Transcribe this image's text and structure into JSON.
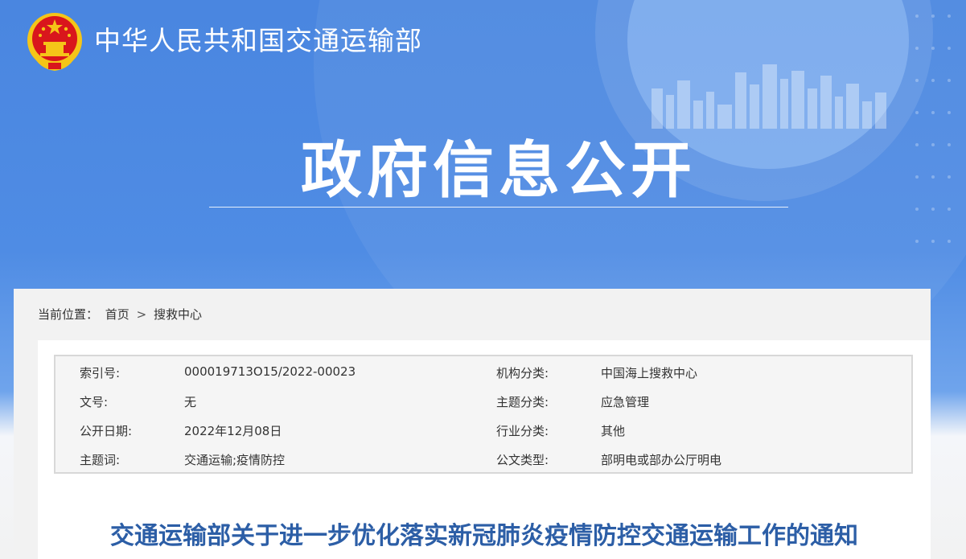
{
  "header": {
    "site_name": "中华人民共和国交通运输部",
    "hero_title": "政府信息公开"
  },
  "breadcrumb": {
    "label": "当前位置：",
    "home": "首页",
    "separator": ">",
    "current": "搜救中心"
  },
  "meta": {
    "rows": [
      {
        "k1": "索引号:",
        "v1": "000019713O15/2022-00023",
        "k2": "机构分类:",
        "v2": "中国海上搜救中心"
      },
      {
        "k1": "文号:",
        "v1": "无",
        "k2": "主题分类:",
        "v2": "应急管理"
      },
      {
        "k1": "公开日期:",
        "v1": "2022年12月08日",
        "k2": "行业分类:",
        "v2": "其他"
      },
      {
        "k1": "主题词:",
        "v1": "交通运输;疫情防控",
        "k2": "公文类型:",
        "v2": "部明电或部办公厅明电"
      }
    ]
  },
  "document": {
    "title": "交通运输部关于进一步优化落实新冠肺炎疫情防控交通运输工作的通知"
  },
  "colors": {
    "banner_blue": "#4a86e0",
    "title_blue": "#2c5ea6",
    "emblem_red": "#d9161c",
    "emblem_gold": "#f5c518"
  },
  "icons": {
    "emblem": "national-emblem-icon"
  }
}
